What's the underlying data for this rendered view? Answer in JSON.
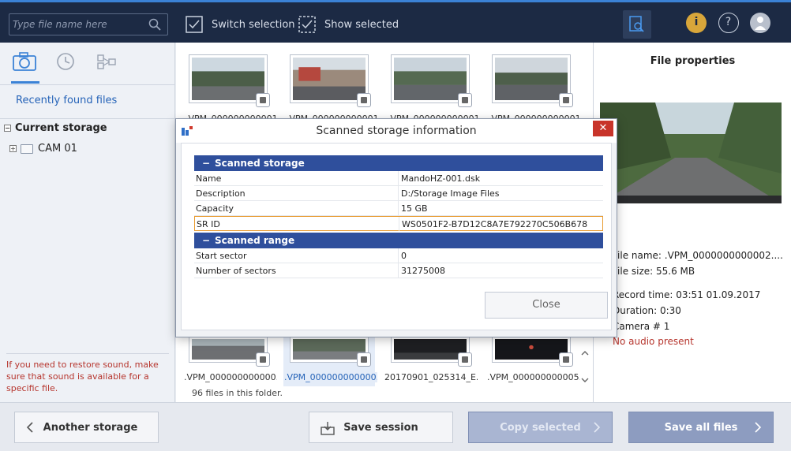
{
  "topbar": {
    "search_placeholder": "Type file name here",
    "switch_selection": "Switch selection",
    "show_selected": "Show selected"
  },
  "left": {
    "recent": "Recently found files",
    "current_storage": "Current storage",
    "cam": "CAM 01",
    "hint": "If you need to restore sound, make sure that sound is available for a specific file."
  },
  "grid": {
    "top_names": [
      ".VPM_000000000001...",
      ".VPM_000000000001...",
      ".VPM_000000000001...",
      ".VPM_000000000001..."
    ],
    "bottom_names": [
      ".VPM_000000000000...",
      ".VPM_000000000000...",
      "20170901_025314_E...",
      ".VPM_000000000005..."
    ],
    "files_count": "96 files in this folder."
  },
  "right": {
    "title": "File properties",
    "props": [
      "File name:  .VPM_0000000000002....",
      "File size:    55.6 MB",
      "Record time:   03:51 01.09.2017",
      "Duration:   0:30",
      "Camera # 1"
    ],
    "no_audio": "No audio present"
  },
  "bottom": {
    "another_storage": "Another storage",
    "save_session": "Save session",
    "copy_selected": "Copy selected",
    "save_all": "Save all files"
  },
  "modal": {
    "title": "Scanned storage information",
    "close_x": "✕",
    "section1": "Scanned storage",
    "section2": "Scanned range",
    "rows1": [
      {
        "k": "Name",
        "v": "MandoHZ-001.dsk"
      },
      {
        "k": "Description",
        "v": "D:/Storage Image Files"
      },
      {
        "k": "Capacity",
        "v": "15 GB"
      },
      {
        "k": "SR ID",
        "v": "WS0501F2-B7D12C8A7E792270C506B678"
      }
    ],
    "rows2": [
      {
        "k": "Start sector",
        "v": "0"
      },
      {
        "k": "Number of sectors",
        "v": "31275008"
      }
    ],
    "close_label": "Close"
  },
  "colors": {
    "topbar": "#1c2a44",
    "accent": "#3b82d6",
    "section_head": "#2f4f9c",
    "hint_red": "#b6352d"
  }
}
